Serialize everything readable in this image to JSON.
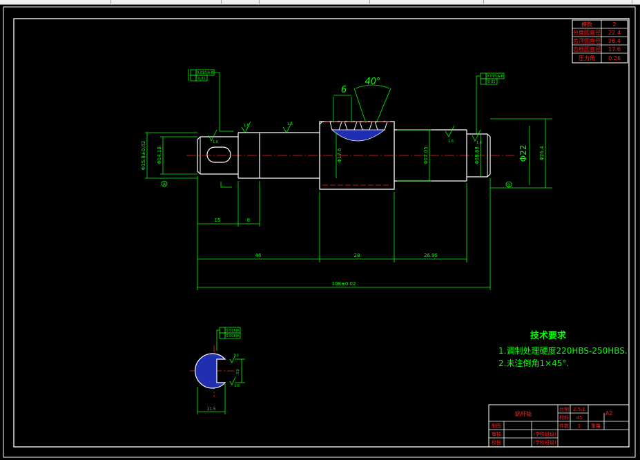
{
  "colors": {
    "background": "#000000",
    "geometry": "#ffffff",
    "dimension": "#00ff00",
    "center": "#ff0000",
    "hatch": "#2a3cff",
    "border": "#ffffff"
  },
  "toolbar": {
    "segments": [
      "",
      "",
      "",
      "",
      "",
      ""
    ]
  },
  "params_table": [
    {
      "label": "模数",
      "value": "2"
    },
    {
      "label": "分度圆直径",
      "value": "22.4"
    },
    {
      "label": "齿顶圆直径",
      "value": "26.4"
    },
    {
      "label": "齿根圆直径",
      "value": "17.6"
    },
    {
      "label": "压力角",
      "value": "0.26"
    }
  ],
  "dimensions": {
    "tooth_width": "6",
    "tooth_angle": "40°",
    "len_15": "15",
    "len_8": "8",
    "len_46": "46",
    "len_28": "28",
    "len_26_95": "26.95",
    "total_length": "108±0.02",
    "dia_left_outer": "Φ15.8±0.02",
    "dia_left_inner": "Φ14.18",
    "dia_worm_root": "Φ17.6",
    "dia_right_step": "Φ17.05",
    "dia_right_end": "Φ18.88",
    "dia_22": "Φ22",
    "dia_26_4": "Φ26.4",
    "section_width": "11.5",
    "section_depth": "3.2",
    "section_rough": "3.2"
  },
  "roughness": {
    "r1": "1.6",
    "r2": "1.6",
    "r3": "1.6",
    "r4": "1.6",
    "r5": "1.6",
    "r6": "1.6"
  },
  "tolerance_frames": {
    "left_top": "0.015|A-B",
    "left_bottom": "0.01",
    "right_top": "0.015|A-B",
    "right_bottom": "0.01",
    "section_top": "0.016|A",
    "section_bottom": "0.008|A"
  },
  "datum": {
    "left": "A",
    "right": "B"
  },
  "tech_requirements": {
    "title": "技术要求",
    "line1": "1.调制处理硬度220HBS-250HBS.",
    "line2": "2.未注倒角1×45°."
  },
  "title_block": {
    "part_name": "蜗杆轴",
    "scale_label": "比例",
    "scale_value": "2.5:1",
    "qty_label": "件数",
    "qty_value": "1",
    "weight_label": "重量",
    "material_label": "材料",
    "material_value": "45",
    "sheet_label": "共张",
    "sheet_size": "A2",
    "drawer_label": "制图",
    "checker_label": "审核",
    "reviewer_label": "校核",
    "org_line1": "(学校班级)",
    "org_line2": "(学校班级)"
  }
}
